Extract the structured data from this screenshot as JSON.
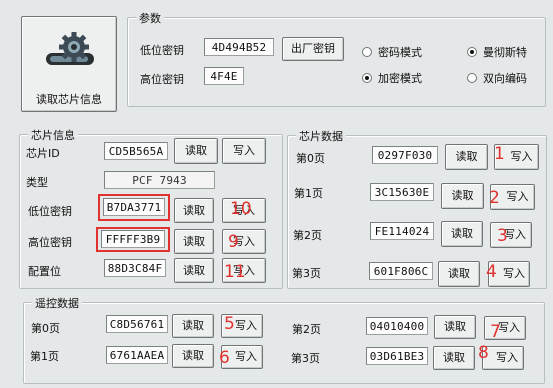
{
  "read_chip_button": {
    "label": "读取芯片信息",
    "icon": "gear-icon"
  },
  "params": {
    "title": "参数",
    "low_key_label": "低位密钥",
    "low_key_value": "4D494B52",
    "high_key_label": "高位密钥",
    "high_key_value": "4F4E",
    "factory_key_button": "出厂密钥",
    "radios": [
      {
        "label": "密码模式",
        "checked": false
      },
      {
        "label": "曼彻斯特",
        "checked": true
      },
      {
        "label": "加密模式",
        "checked": true
      },
      {
        "label": "双向编码",
        "checked": false
      }
    ]
  },
  "chip_info": {
    "title": "芯片信息",
    "rows": [
      {
        "label": "芯片ID",
        "value": "CD5B565A",
        "read": "读取",
        "write": "写入",
        "annotation": ""
      },
      {
        "label": "类型",
        "value": "PCF 7943"
      },
      {
        "label": "低位密钥",
        "value": "B7DA3771",
        "read": "读取",
        "write": "写入",
        "annotation": "10"
      },
      {
        "label": "高位密钥",
        "value": "FFFFF3B9",
        "read": "读取",
        "write": "写入",
        "annotation": "9"
      },
      {
        "label": "配置位",
        "value": "88D3C84F",
        "read": "读取",
        "write": "写入",
        "annotation": "11"
      }
    ]
  },
  "chip_data": {
    "title": "芯片数据",
    "rows": [
      {
        "label": "第0页",
        "value": "0297F030",
        "read": "读取",
        "write": "写入",
        "annotation": "1"
      },
      {
        "label": "第1页",
        "value": "3C15630E",
        "read": "读取",
        "write": "写入",
        "annotation": "2"
      },
      {
        "label": "第2页",
        "value": "FE114024",
        "read": "读取",
        "write": "写入",
        "annotation": "3"
      },
      {
        "label": "第3页",
        "value": "601F806C",
        "read": "读取",
        "write": "写入",
        "annotation": "4"
      }
    ]
  },
  "remote_data": {
    "title": "遥控数据",
    "rows": [
      {
        "label": "第0页",
        "value": "C8D56761",
        "read": "读取",
        "write": "写入",
        "annotation": "5"
      },
      {
        "label": "第1页",
        "value": "6761AAEA",
        "read": "读取",
        "write": "写入",
        "annotation": "6"
      },
      {
        "label": "第2页",
        "value": "04010400",
        "read": "读取",
        "write": "写入",
        "annotation": "7"
      },
      {
        "label": "第3页",
        "value": "03D61BE3",
        "read": "读取",
        "write": "写入",
        "annotation": "8"
      }
    ]
  },
  "colors": {
    "annotation": "#e0322f",
    "background": "#e4e8e8"
  }
}
